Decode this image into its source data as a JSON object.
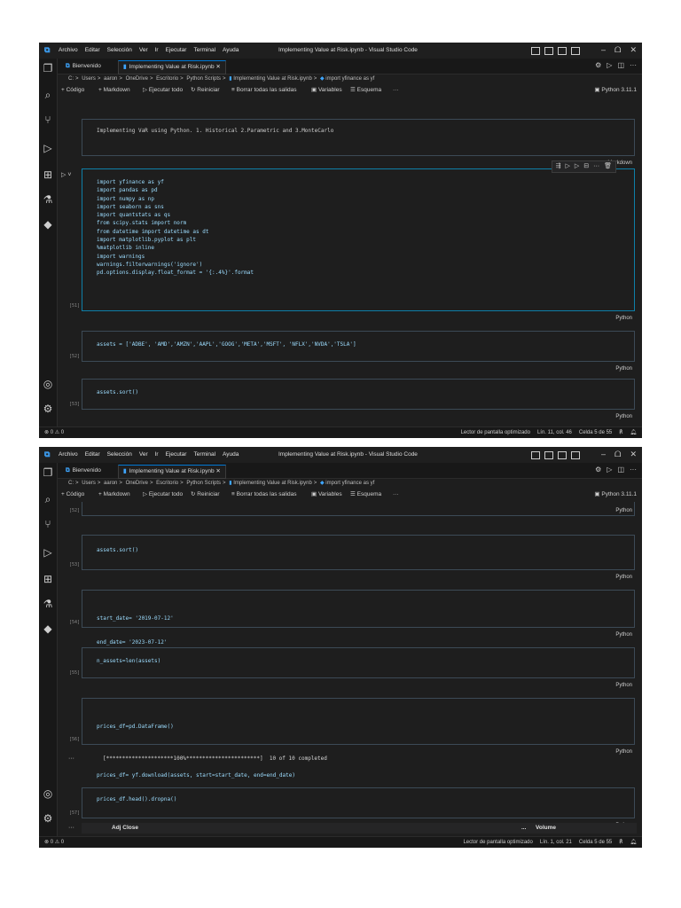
{
  "menu": [
    "Archivo",
    "Editar",
    "Selección",
    "Ver",
    "Ir",
    "Ejecutar",
    "Terminal",
    "Ayuda"
  ],
  "window_title": "Implementing Value at Risk.ipynb - Visual Studio Code",
  "window_controls": {
    "minimize": "–",
    "restore": "ᗝ",
    "close": "✕"
  },
  "tabs": {
    "welcome": "Bienvenido",
    "notebook": "Implementing Value at Risk.ipynb",
    "close": "✕"
  },
  "breadcrumbs": {
    "win1": [
      "C:",
      "Users",
      "aaron",
      "OneDrive",
      "Escritorio",
      "Python Scripts",
      "Implementing Value at Risk.ipynb",
      "import yfinance as yf"
    ],
    "win2": [
      "C:",
      "Users",
      "aaron",
      "OneDrive",
      "Escritorio",
      "Python Scripts",
      "Implementing Value at Risk.ipynb",
      "import yfinance as yf"
    ]
  },
  "toolbar": {
    "code": "+ Código",
    "markdown": "+ Markdown",
    "run_all": "Ejecutar todo",
    "restart": "Reiniciar",
    "clear": "Borrar todas las salidas",
    "variables": "Variables",
    "outline": "Esquema",
    "more": "···",
    "kernel": "Python 3.11.1"
  },
  "win1": {
    "markdown_text": "Implementing VaR using Python. 1. Historical 2.Parametric and 3.MonteCarlo",
    "markdown_label": "Markdown",
    "cell1_lines": [
      "import yfinance as yf",
      "import pandas as pd",
      "import numpy as np",
      "import seaborn as sns",
      "import quantstats as qs",
      "from scipy.stats import norm",
      "from datetime import datetime as dt",
      "import matplotlib.pyplot as plt",
      "%matplotlib inline",
      "import warnings",
      "warnings.filterwarnings('ignore')",
      "pd.options.display.float_format = '{:.4%}'.format"
    ],
    "cell1_exec": "[51]",
    "cell2_line": "assets = ['ADBE', 'AMD','AMZN','AAPL','GOOG','META','MSFT', 'NFLX','NVDA','TSLA']",
    "cell2_exec": "[52]",
    "cell3_line": "assets.sort()",
    "cell3_exec": "[53]",
    "lang": "Python",
    "status_left": "⊗ 0 ⚠ 0",
    "status_right": [
      "Lector de pantalla optimizado",
      "Lín. 11, col. 46",
      "Celda 5 de 55"
    ]
  },
  "win2": {
    "top_exec": "[52]",
    "cell_a": "assets.sort()",
    "cell_a_exec": "[53]",
    "cell_b_lines": [
      "start_date= '2019-07-12'",
      "end_date= '2023-07-12'"
    ],
    "cell_b_exec": "[54]",
    "cell_c": "n_assets=len(assets)",
    "cell_c_exec": "[55]",
    "cell_d_lines": [
      "prices_df=pd.DataFrame()",
      "",
      "prices_df= yf.download(assets, start=start_date, end=end_date)"
    ],
    "cell_d_exec": "[56]",
    "cell_d_output": "[*********************100%***********************]  10 of 10 completed",
    "cell_e": "prices_df.head().dropna()",
    "cell_e_exec": "[57]",
    "df_headers": {
      "adj": "Adj Close",
      "vol": "Volume"
    },
    "lang": "Python",
    "status_left": "⊗ 0 ⚠ 0",
    "status_right": [
      "Lector de pantalla optimizado",
      "Lín. 1, col. 21",
      "Celda 5 de 55"
    ]
  },
  "colors": {
    "accent": "#0078d4",
    "keyword": "#c586c0",
    "string": "#ce9178",
    "background": "#1e1e1e"
  }
}
